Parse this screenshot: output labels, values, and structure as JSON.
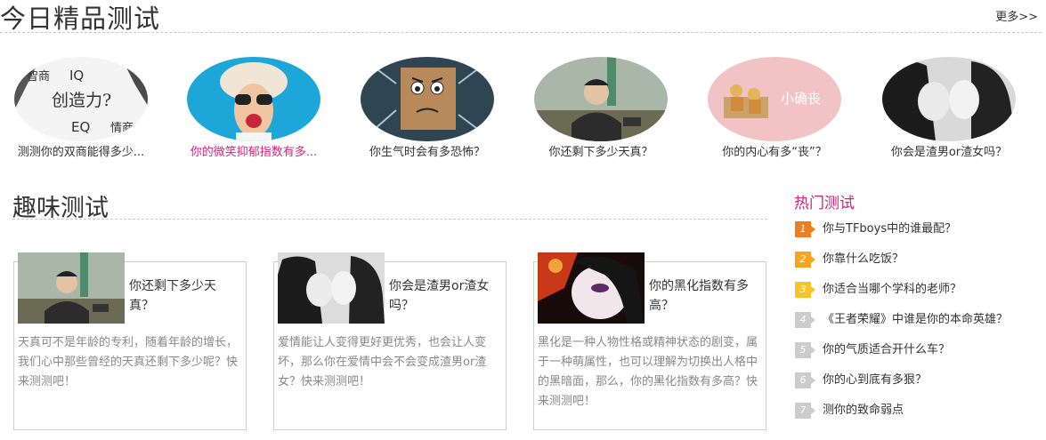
{
  "header": {
    "title": "今日精品测试",
    "more": "更多>>"
  },
  "featured": [
    {
      "title": "测测你的双商能得多少...",
      "icon": "iq-eq-words-image",
      "image_text": {
        "tl": "智商",
        "tr": "IQ",
        "mid": "创造力?",
        "bl": "EQ",
        "br": "情商"
      }
    },
    {
      "title": "你的微笑抑郁指数有多...",
      "icon": "smiling-woman-image",
      "highlight": true
    },
    {
      "title": "你生气时会有多恐怖？",
      "icon": "angry-box-image"
    },
    {
      "title": "你还剩下多少天真？",
      "icon": "leader-photo-image"
    },
    {
      "title": "你的内心有多“丧”？",
      "icon": "lazy-cartoon-image",
      "image_text": "小确丧"
    },
    {
      "title": "你会是渣男or渣女吗？",
      "icon": "couple-kiss-image"
    }
  ],
  "fun": {
    "title": "趣味测试",
    "cards": [
      {
        "title": "你还剩下多少天真？",
        "desc": "天真可不是年龄的专利，随着年龄的增长，我们心中那些曾经的天真还剩下多少呢？快来测测吧！",
        "icon": "leader-photo-image"
      },
      {
        "title": "你会是渣男or渣女吗？",
        "desc": "爱情能让人变得更好更优秀，也会让人变坏，那么你在爱情中会不会变成渣男or渣女？快来测测吧！",
        "icon": "couple-kiss-image"
      },
      {
        "title": "你的黑化指数有多高？",
        "desc": "黑化是一种人物性格或精神状态的剧变，属于一种萌属性，也可以理解为切换出人格中的黑暗面，那么，你的黑化指数有多高？快来测测吧！",
        "icon": "dark-anime-image"
      }
    ]
  },
  "hot": {
    "title": "热门测试",
    "items": [
      {
        "num": "1",
        "text": "你与TFboys中的谁最配？",
        "color": "#f07d1e"
      },
      {
        "num": "2",
        "text": "你靠什么吃饭？",
        "color": "#f7a51c"
      },
      {
        "num": "3",
        "text": "你适合当哪个学科的老师？",
        "color": "#f8c42a"
      },
      {
        "num": "4",
        "text": "《王者荣耀》中谁是你的本命英雄？",
        "color": "#cccccc"
      },
      {
        "num": "5",
        "text": "你的气质适合开什么车？",
        "color": "#cccccc"
      },
      {
        "num": "6",
        "text": "你的心到底有多狠？",
        "color": "#cccccc"
      },
      {
        "num": "7",
        "text": "测你的致命弱点",
        "color": "#cccccc"
      }
    ]
  }
}
